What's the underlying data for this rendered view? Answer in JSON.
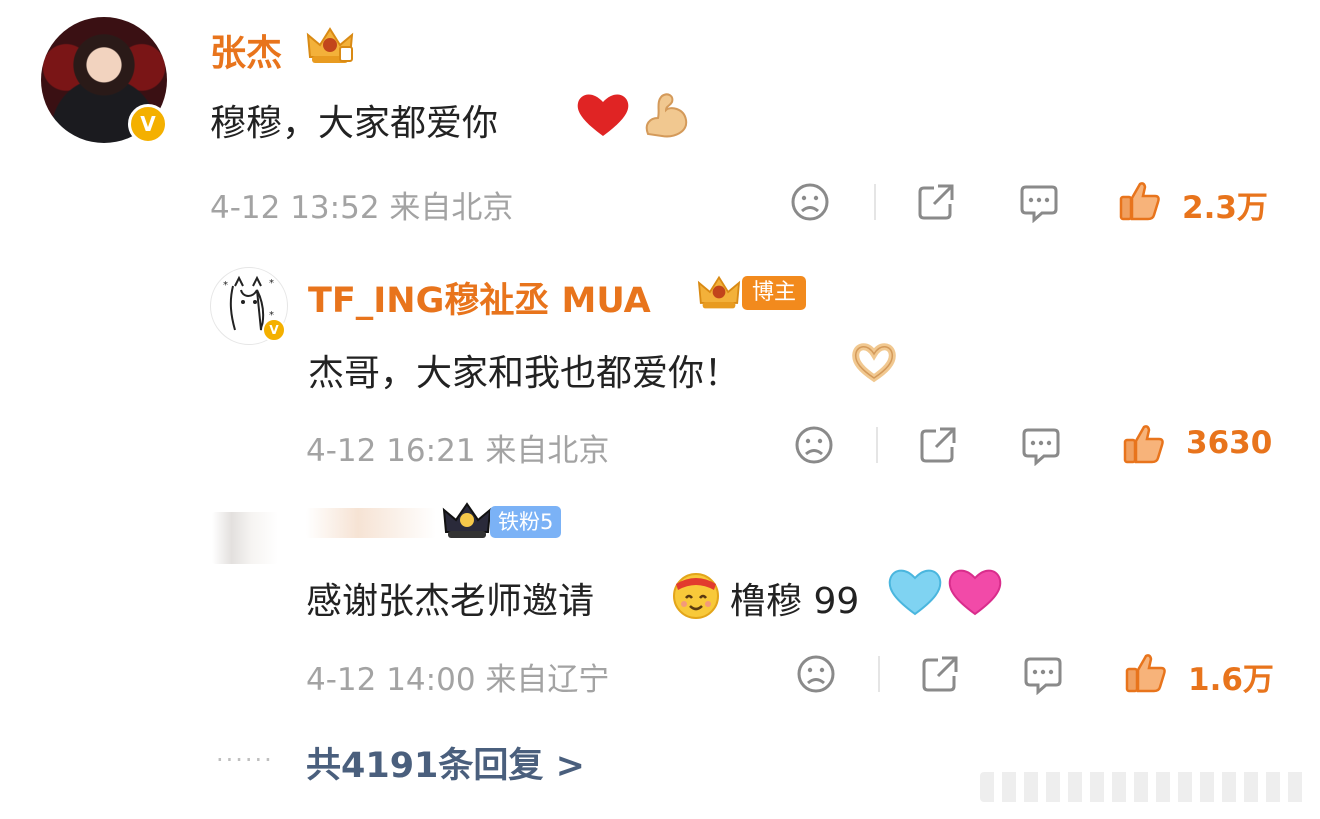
{
  "main_comment": {
    "author": "张杰",
    "text": "穆穆，大家都爱你",
    "emojis": [
      "❤️",
      "💪"
    ],
    "time": "4-12 13:52",
    "location": "来自北京",
    "likes": "2.3万",
    "icons": [
      "sad-face-icon",
      "share-icon",
      "comment-icon",
      "thumbs-up-icon"
    ]
  },
  "replies": [
    {
      "author": "TF_ING穆祉丞 MUA",
      "tag": "博主",
      "text": "杰哥，大家和我也都爱你！",
      "emojis": [
        "🫶"
      ],
      "time": "4-12 16:21",
      "location": "来自北京",
      "likes": "3630"
    },
    {
      "author": "",
      "tag": "铁粉5",
      "text": "感谢张杰老师邀请",
      "emojis": [
        "🥳"
      ],
      "text2": "橹穆 99",
      "emojis2": [
        "🩵",
        "💗"
      ],
      "time": "4-12 14:00",
      "location": "来自辽宁",
      "likes": "1.6万"
    }
  ],
  "more_replies": "共4191条回复 >",
  "colors": {
    "accent": "#e8741c",
    "link": "#4a5f7d",
    "meta": "#a3a3a3",
    "verified": "#f4b000"
  }
}
